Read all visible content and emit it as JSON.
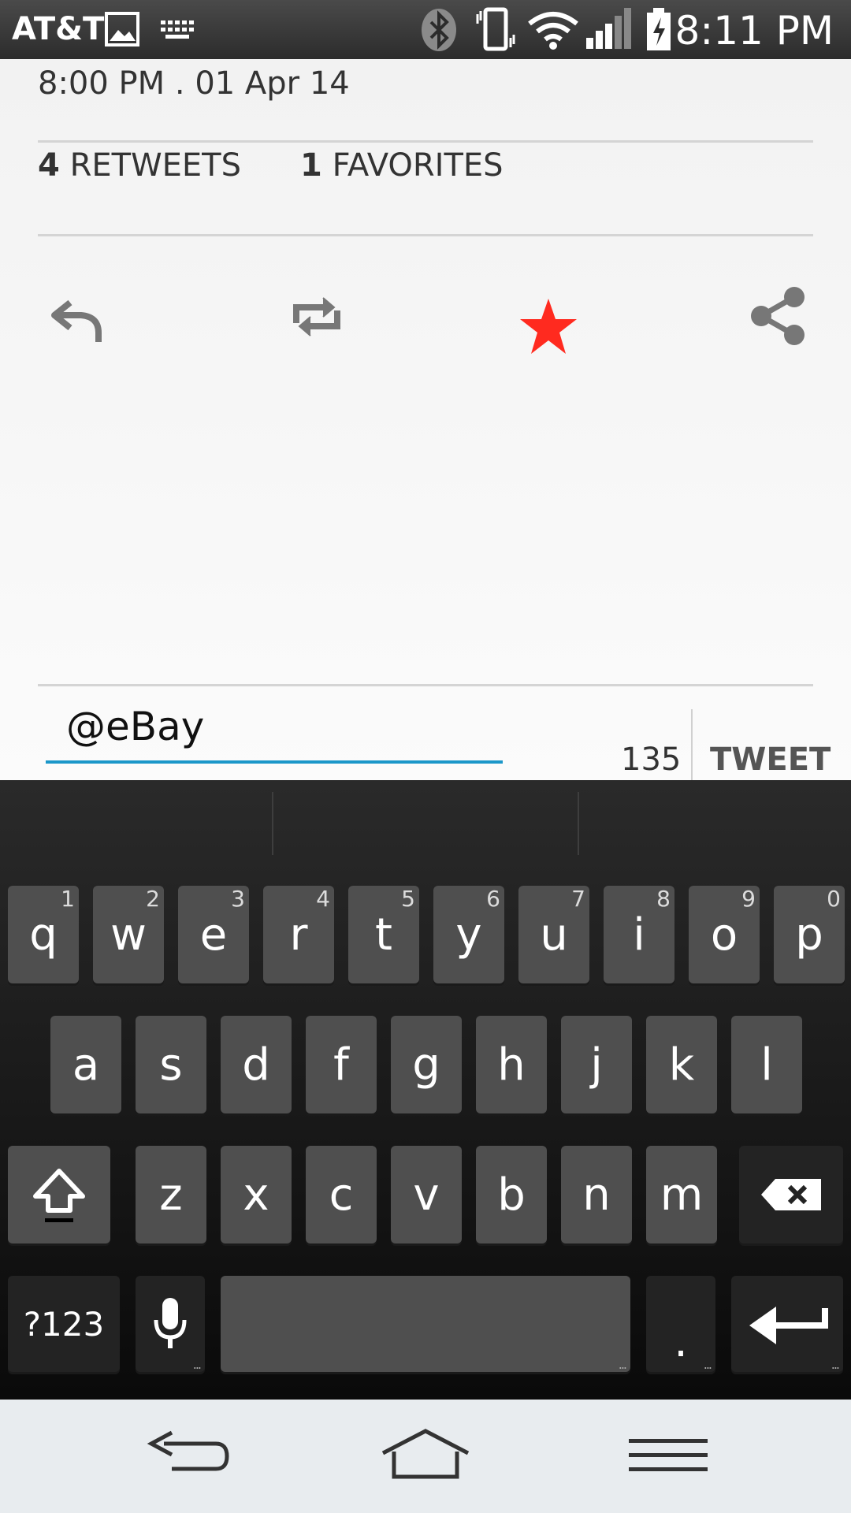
{
  "status_bar": {
    "carrier": "AT&T",
    "time": "8:11 PM",
    "icons": [
      "image-icon",
      "keyboard-icon",
      "bluetooth-icon",
      "vibrate-icon",
      "wifi-icon",
      "signal-icon",
      "battery-charging-icon"
    ]
  },
  "tweet": {
    "timestamp": "8:00 PM . 01 Apr 14",
    "retweets_count": "4",
    "retweets_label": "RETWEETS",
    "favorites_count": "1",
    "favorites_label": "FAVORITES",
    "favorited": true,
    "accent_color": "#ff2a1f"
  },
  "reply": {
    "text": "@eBay",
    "char_count": "135",
    "tweet_button": "TWEET",
    "underline_color": "#1b97c9"
  },
  "keyboard": {
    "row1": [
      {
        "k": "q",
        "h": "1"
      },
      {
        "k": "w",
        "h": "2"
      },
      {
        "k": "e",
        "h": "3"
      },
      {
        "k": "r",
        "h": "4"
      },
      {
        "k": "t",
        "h": "5"
      },
      {
        "k": "y",
        "h": "6"
      },
      {
        "k": "u",
        "h": "7"
      },
      {
        "k": "i",
        "h": "8"
      },
      {
        "k": "o",
        "h": "9"
      },
      {
        "k": "p",
        "h": "0"
      }
    ],
    "row2": [
      "a",
      "s",
      "d",
      "f",
      "g",
      "h",
      "j",
      "k",
      "l"
    ],
    "row3": [
      "z",
      "x",
      "c",
      "v",
      "b",
      "n",
      "m"
    ],
    "symbols_key": "?123",
    "period_key": ".",
    "dots": "..."
  },
  "nav_bar": {
    "icons": [
      "back-icon",
      "home-icon",
      "menu-icon"
    ]
  }
}
